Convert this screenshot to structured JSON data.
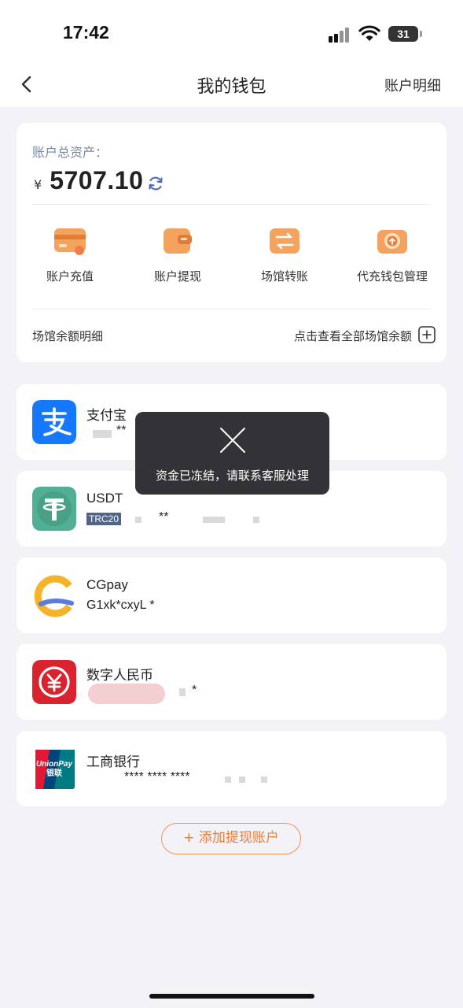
{
  "status_bar": {
    "time": "17:42",
    "battery": "31"
  },
  "nav": {
    "title": "我的钱包",
    "action": "账户明细"
  },
  "assets": {
    "label": "账户总资产：",
    "currency": "¥",
    "amount": "5707.10",
    "actions": [
      {
        "label": "账户充值",
        "icon": "card-recharge-icon"
      },
      {
        "label": "账户提现",
        "icon": "wallet-withdraw-icon"
      },
      {
        "label": "场馆转账",
        "icon": "transfer-icon"
      },
      {
        "label": "代充钱包管理",
        "icon": "agent-wallet-icon"
      }
    ],
    "venue_label": "场馆余额明细",
    "venue_link": "点击查看全部场馆余额"
  },
  "accounts": [
    {
      "name": "支付宝",
      "number": "**",
      "icon": "alipay-logo"
    },
    {
      "name": "USDT",
      "badge": "TRC20",
      "number": "**",
      "icon": "tether-logo"
    },
    {
      "name": "CGpay",
      "number": "G1xk*cxyL *",
      "icon": "cgpay-logo"
    },
    {
      "name": "数字人民币",
      "number": "*",
      "icon": "ecny-logo"
    },
    {
      "name": "工商银行",
      "number": "**** **** ****",
      "icon": "unionpay-logo"
    }
  ],
  "add_button": "+ 添加提现账户",
  "toast": {
    "message": "资金已冻结，请联系客服处理",
    "icon": "close-icon"
  },
  "colors": {
    "accent": "#ee7b36",
    "label_blue": "#7a86a6",
    "toast_bg": "#28282c"
  }
}
